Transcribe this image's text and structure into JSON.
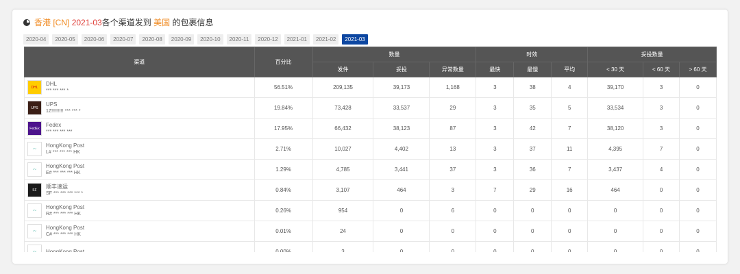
{
  "title": {
    "origin": "香港 [CN]",
    "month": "2021-03",
    "middle": "各个渠道发到",
    "dest": "美国",
    "suffix": "的包裹信息"
  },
  "months": [
    "2020-04",
    "2020-05",
    "2020-06",
    "2020-07",
    "2020-08",
    "2020-09",
    "2020-10",
    "2020-11",
    "2020-12",
    "2021-01",
    "2021-02",
    "2021-03"
  ],
  "active_month": "2021-03",
  "headers": {
    "channel": "渠道",
    "percent": "百分比",
    "qty": "数量",
    "timeliness": "时效",
    "delivered_qty": "妥投数量",
    "sent": "发件",
    "delivered": "妥投",
    "abnormal": "异常数量",
    "fastest": "最快",
    "slowest": "最慢",
    "average": "平均",
    "lt30": "< 30 天",
    "lt60": "< 60 天",
    "gt60": "> 60 天"
  },
  "rows": [
    {
      "name": "DHL",
      "no": "*** *** *** *",
      "logo": "dhl",
      "color": "#ffcc00",
      "vals": [
        "56.51%",
        "209,135",
        "39,173",
        "1,168",
        "3",
        "38",
        "4",
        "39,170",
        "3",
        "0"
      ]
    },
    {
      "name": "UPS",
      "no": "1Z!!!!!!!!! *** *** *",
      "logo": "ups",
      "color": "#3b1f16",
      "vals": [
        "19.84%",
        "73,428",
        "33,537",
        "29",
        "3",
        "35",
        "5",
        "33,534",
        "3",
        "0"
      ]
    },
    {
      "name": "Fedex",
      "no": "*** *** *** ***",
      "logo": "fedex",
      "color": "#4d148c",
      "vals": [
        "17.95%",
        "66,432",
        "38,123",
        "87",
        "3",
        "42",
        "7",
        "38,120",
        "3",
        "0"
      ]
    },
    {
      "name": "HongKong Post",
      "no": "L# *** *** *** HK",
      "logo": "hkpost",
      "color": "#ffffff",
      "vals": [
        "2.71%",
        "10,027",
        "4,402",
        "13",
        "3",
        "37",
        "11",
        "4,395",
        "7",
        "0"
      ]
    },
    {
      "name": "HongKong Post",
      "no": "E# *** *** *** HK",
      "logo": "hkpost",
      "color": "#ffffff",
      "vals": [
        "1.29%",
        "4,785",
        "3,441",
        "37",
        "3",
        "36",
        "7",
        "3,437",
        "4",
        "0"
      ]
    },
    {
      "name": "顺丰速运",
      "no": "SF *** *** *** *** *",
      "logo": "sf",
      "color": "#1a1a1a",
      "vals": [
        "0.84%",
        "3,107",
        "464",
        "3",
        "7",
        "29",
        "16",
        "464",
        "0",
        "0"
      ]
    },
    {
      "name": "HongKong Post",
      "no": "R# *** *** *** HK",
      "logo": "hkpost",
      "color": "#ffffff",
      "vals": [
        "0.26%",
        "954",
        "0",
        "6",
        "0",
        "0",
        "0",
        "0",
        "0",
        "0"
      ]
    },
    {
      "name": "HongKong Post",
      "no": "C# *** *** *** HK",
      "logo": "hkpost",
      "color": "#ffffff",
      "vals": [
        "0.01%",
        "24",
        "0",
        "0",
        "0",
        "0",
        "0",
        "0",
        "0",
        "0"
      ]
    },
    {
      "name": "HongKong Post",
      "no": "",
      "logo": "hkpost",
      "color": "#ffffff",
      "vals": [
        "0.00%",
        "3",
        "0",
        "0",
        "0",
        "0",
        "0",
        "0",
        "0",
        "0"
      ]
    }
  ]
}
